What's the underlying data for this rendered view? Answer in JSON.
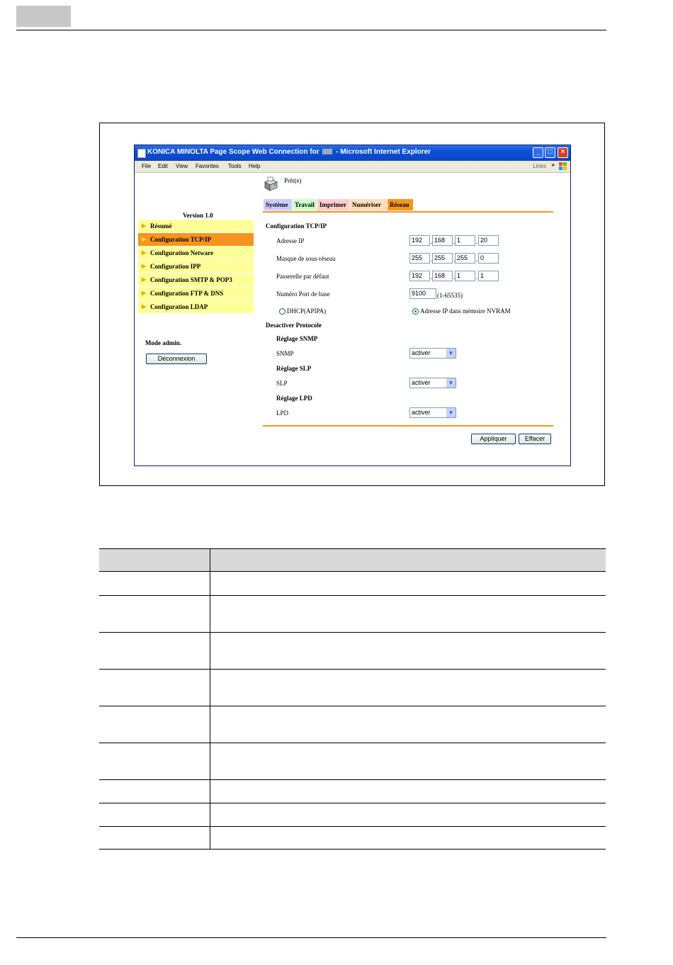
{
  "window": {
    "title": "KONICA MINOLTA Page Scope Web Connection for [] - Microsoft Internet Explorer",
    "title_left": "KONICA MINOLTA Page Scope Web Connection for",
    "title_right": "- Microsoft Internet Explorer"
  },
  "menu": {
    "items": [
      "File",
      "Edit",
      "View",
      "Favorites",
      "Tools",
      "Help"
    ],
    "links": "Links"
  },
  "status": "Prêt(e)",
  "tabs": [
    {
      "label": "Système",
      "color": "#ccccff"
    },
    {
      "label": "Travail",
      "color": "#ccffcc"
    },
    {
      "label": "Imprimer",
      "color": "#ffcccc"
    },
    {
      "label": "Numériser",
      "color": "#ffddbb"
    },
    {
      "label": "Réseau",
      "color": "#f7941d"
    }
  ],
  "sidebar": {
    "version": "Version 1.0",
    "items": [
      {
        "label": "Résumé",
        "active": false
      },
      {
        "label": "Configuration TCP/IP",
        "active": true
      },
      {
        "label": "Configuration Netware",
        "active": false
      },
      {
        "label": "Configuration IPP",
        "active": false
      },
      {
        "label": "Configuration SMTP & POP3",
        "active": false
      },
      {
        "label": "Configuration FTP & DNS",
        "active": false
      },
      {
        "label": "Configuration LDAP",
        "active": false
      }
    ],
    "admin_label": "Mode admin.",
    "logout_button": "Déconnexion"
  },
  "form": {
    "section_title": "Configuration TCP/IP",
    "ip_label": "Adresse IP",
    "ip": [
      "192",
      "168",
      "1",
      "20"
    ],
    "mask_label": "Masque de sous-réseau",
    "mask": [
      "255",
      "255",
      "255",
      "0"
    ],
    "gateway_label": "Passerelle par défaut",
    "gateway": [
      "192",
      "168",
      "1",
      "1"
    ],
    "port_label": "Numéro Port de base",
    "port": "9100",
    "port_range": "(1-65535)",
    "radio_dhcp": "DHCP(APIPA)",
    "radio_nvram": "Adresse IP dans mémoire NVRAM",
    "radio_selected": "nvram",
    "disable_title": "Desactiver Protocole",
    "snmp_group": "Réglage SNMP",
    "snmp_label": "SNMP",
    "snmp_value": "activer",
    "slp_group": "Réglage SLP",
    "slp_label": "SLP",
    "slp_value": "activer",
    "lpd_group": "Réglage LPD",
    "lpd_label": "LPD",
    "lpd_value": "activer",
    "apply_button": "Appliquer",
    "clear_button": "Effacer"
  },
  "colors": {
    "accent": "#f7941d",
    "sidebar_bg": "#ffff99",
    "titlebar": "#0b4fd6"
  }
}
